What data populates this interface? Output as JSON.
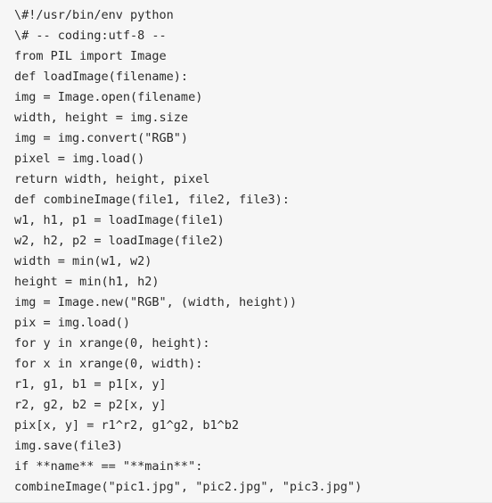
{
  "code": {
    "lines": [
      "\\#!/usr/bin/env python",
      "\\# -- coding:utf-8 --",
      "from PIL import Image",
      "def loadImage(filename):",
      "img = Image.open(filename)",
      "width, height = img.size",
      "img = img.convert(\"RGB\")",
      "pixel = img.load()",
      "return width, height, pixel",
      "def combineImage(file1, file2, file3):",
      "w1, h1, p1 = loadImage(file1)",
      "w2, h2, p2 = loadImage(file2)",
      "width = min(w1, w2)",
      "height = min(h1, h2)",
      "img = Image.new(\"RGB\", (width, height))",
      "pix = img.load()",
      "for y in xrange(0, height):",
      "for x in xrange(0, width):",
      "r1, g1, b1 = p1[x, y]",
      "r2, g2, b2 = p2[x, y]",
      "pix[x, y] = r1^r2, g1^g2, b1^b2",
      "img.save(file3)",
      "if **name** == \"**main**\":",
      "combineImage(\"pic1.jpg\", \"pic2.jpg\", \"pic3.jpg\")"
    ]
  },
  "colors": {
    "background": "#f6f6f6",
    "text": "#2b2b2b"
  }
}
